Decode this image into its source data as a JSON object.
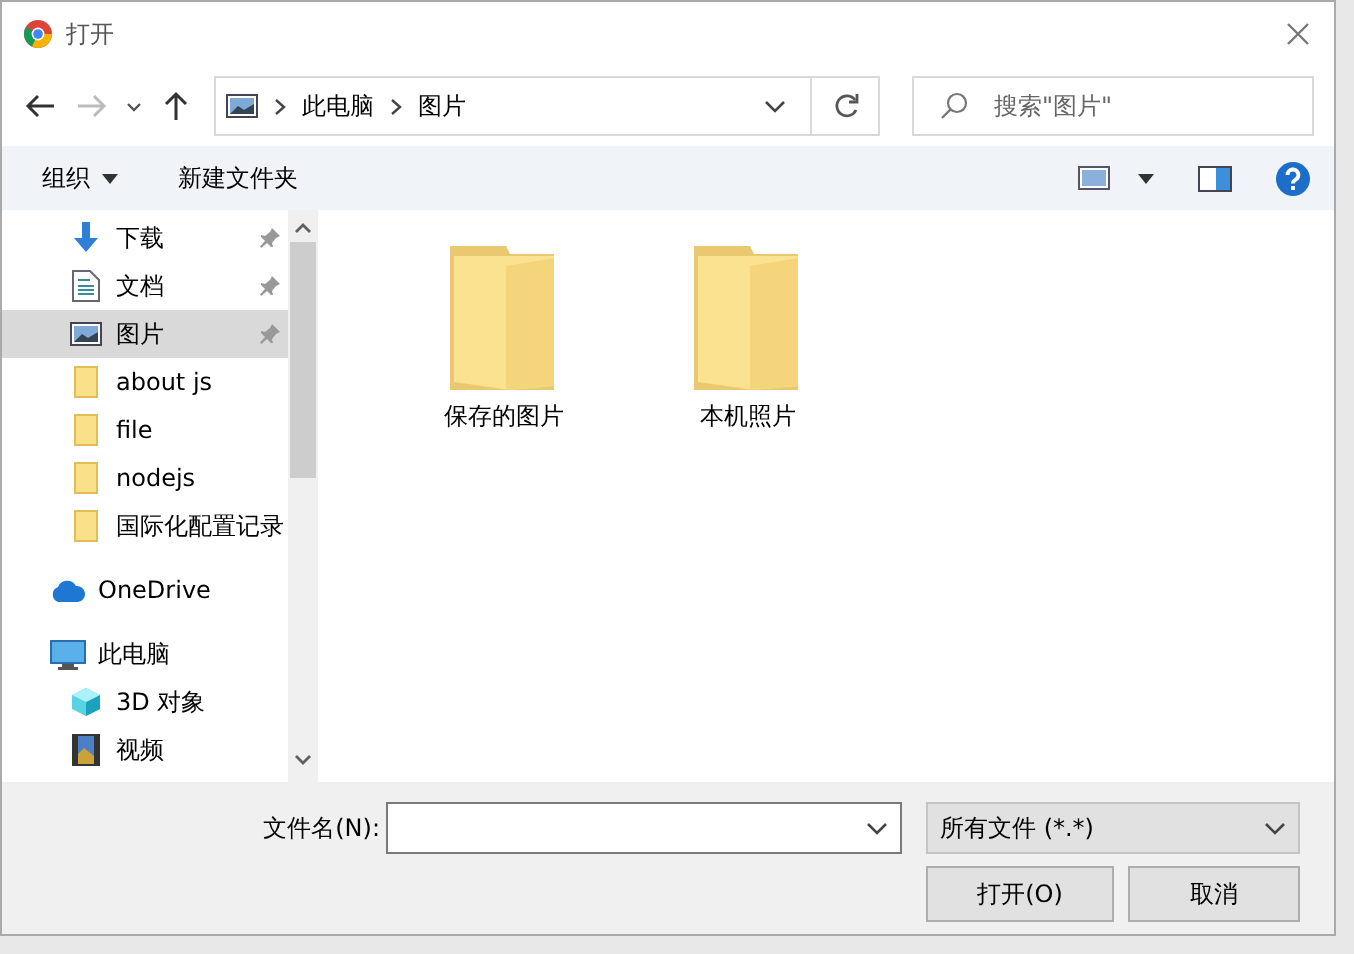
{
  "window": {
    "title": "打开"
  },
  "address": {
    "crumbs": [
      "此电脑",
      "图片"
    ]
  },
  "search": {
    "placeholder": "搜索\"图片\""
  },
  "toolbar": {
    "organize": "组织",
    "new_folder": "新建文件夹"
  },
  "nav": {
    "quick_items": [
      {
        "label": "下载",
        "kind": "download",
        "pinned": true,
        "selected": false
      },
      {
        "label": "文档",
        "kind": "document",
        "pinned": true,
        "selected": false
      },
      {
        "label": "图片",
        "kind": "picture",
        "pinned": true,
        "selected": true
      },
      {
        "label": "about js",
        "kind": "folder",
        "pinned": false,
        "selected": false
      },
      {
        "label": "file",
        "kind": "folder",
        "pinned": false,
        "selected": false
      },
      {
        "label": "nodejs",
        "kind": "folder",
        "pinned": false,
        "selected": false
      },
      {
        "label": "国际化配置记录",
        "kind": "folder",
        "pinned": false,
        "selected": false
      }
    ],
    "roots": [
      {
        "label": "OneDrive",
        "kind": "onedrive",
        "selected": false
      },
      {
        "label": "此电脑",
        "kind": "pc",
        "selected": false,
        "children": [
          {
            "label": "3D 对象",
            "kind": "cube",
            "selected": false
          },
          {
            "label": "视频",
            "kind": "video",
            "selected": false
          }
        ]
      }
    ]
  },
  "files": [
    {
      "name": "保存的图片"
    },
    {
      "name": "本机照片"
    }
  ],
  "filename": {
    "label": "文件名(N):"
  },
  "filetype": {
    "value": "所有文件 (*.*)"
  },
  "buttons": [
    "打开(O)",
    "取消"
  ]
}
